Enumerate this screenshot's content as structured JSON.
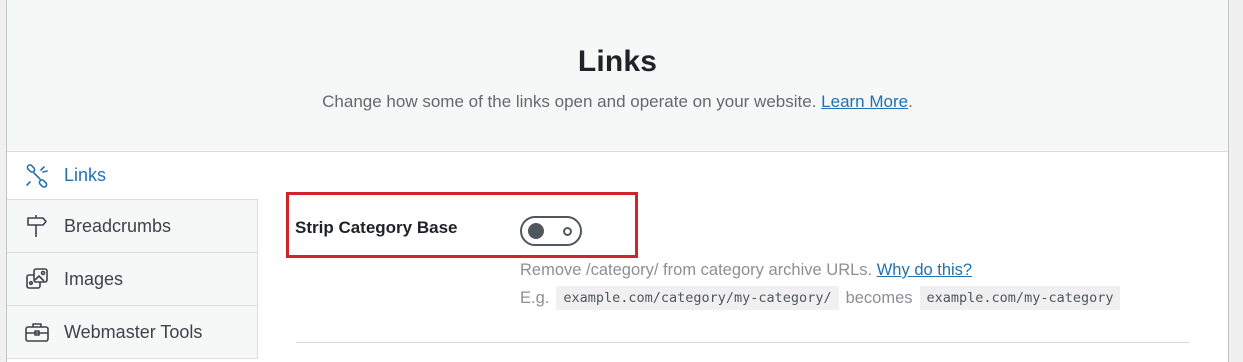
{
  "header": {
    "title": "Links",
    "subtitle": "Change how some of the links open and operate on your website.",
    "learn_more": "Learn More",
    "trailing": "."
  },
  "sidebar": {
    "items": [
      {
        "label": "Links",
        "icon": "links-icon",
        "active": true
      },
      {
        "label": "Breadcrumbs",
        "icon": "signpost-icon",
        "active": false
      },
      {
        "label": "Images",
        "icon": "images-icon",
        "active": false
      },
      {
        "label": "Webmaster Tools",
        "icon": "toolbox-icon",
        "active": false
      }
    ]
  },
  "setting": {
    "label": "Strip Category Base",
    "toggle_on": false,
    "description": "Remove /category/ from category archive URLs.",
    "why_link": "Why do this?",
    "example_prefix": "E.g.",
    "example_from": "example.com/category/my-category/",
    "example_middle": "becomes",
    "example_to": "example.com/my-category"
  },
  "colors": {
    "accent": "#2271b1",
    "highlight_border": "#d2232a"
  }
}
